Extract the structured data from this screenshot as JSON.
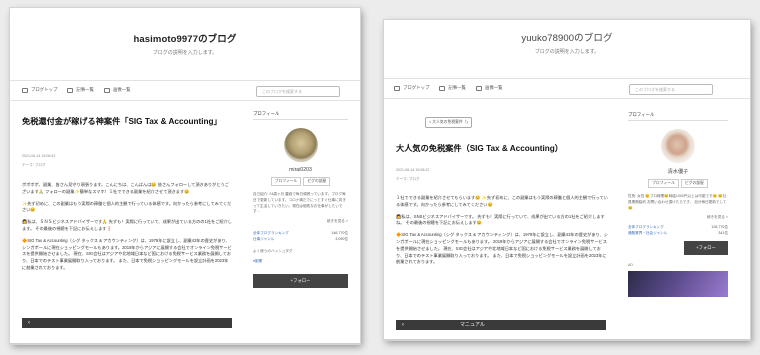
{
  "left": {
    "blog_title": "hasimoto9977のブログ",
    "blog_desc": "ブログの説明を入力します。",
    "menu": [
      "ブログトップ",
      "記事一覧",
      "画像一覧"
    ],
    "search_placeholder": "このブログを検索する",
    "article_title": "免税還付金が稼げる神案件「SIG Tax & Accounting」",
    "date": "2021-06-14 15:06:42",
    "category": "テーマ: ブログ",
    "paragraphs": [
      "ボボボボ、副業、皆さん見守り頑張ります。こんにちは、こんばんは😊 皆さんフォローして頂きありがとうございます🙏 フォローの副業✨簡単なスマホ！１社でできる副業を紹介させて頂きます😊",
      "✨先ず初めに、この副業はもう実際の稼働と個人的主観で行っている体感です。向かったら参考にしてみてください😊",
      "👩私は、ＳＮＳビジネスアドバイザーです🙏 先ずも！実際に行っていて、成果が出ている方のの1社をご紹介します。 その最後の視聴を下記にお伝えします❗",
      "🔶SIG Tax & Accounting（シグ タックス & アカウンティング）は、1979年に設立し、副業43年の歴史があり、シンガポールに現在ショッピングモールもあります。2019年からアジアに展開する会社でオンライン免税サービスを提供開始させました。 現在、SIG会社はアジアや北地域日本など国における免税サービス業務を展開しており、日本でのテスト事業展開取り入っております。 また、日本で免税ショッピングモールを設立計画を2023年に創業されております。"
    ],
    "profile_heading": "プロフィール",
    "username": "mirai0203",
    "profile_btns": [
      "プロフィール",
      "ピグの部屋"
    ],
    "profile_desc": "自己紹介: 24歳ヶ月 農経で毎日頑張っています。ブログ毎日で更新しています。コロナ禍だでにっとすぐ仕事に向きって生活していきたい。現在は個別なお仕事がしたいです...",
    "read_more": "続きを見る >",
    "rankings": [
      {
        "label": "全体ブログランキング",
        "value": "146,770位"
      },
      {
        "label": "仕事ジャンル",
        "value": "3,090位"
      }
    ],
    "recent_label": "よく使うのハッシュタグ",
    "tag_link": "#副業",
    "follow_label": "+フォロー"
  },
  "right": {
    "blog_title": "yuuko78900のブログ",
    "blog_desc": "ブログの説明を入力します。",
    "menu": [
      "ブログトップ",
      "記事一覧",
      "画像一覧"
    ],
    "search_placeholder": "このブログを検索する",
    "prev_tag": "< 大人気の免税案件（)",
    "article_title": "大人気の免税案件（SIG Tax & Accounting）",
    "date": "2021-06-14 15:06:22",
    "category": "テーマ: ブログ",
    "paragraphs": [
      "１社でできる副業を紹介させてもらいます😊 ✨先ず初めに、この副業はもう実際の稼働と個人的主観で行っている体感です。向かったら参考にしてみてください😊",
      "👩私は、SNSビジネスアドバイザーです。 先ずも！実際に行っていて、成果が出ている方の1社をご紹介しますね。 その最後の視聴を下記にお伝えします😊",
      "🔶SIG Tax & Accounting（シグ タックス & アカウンティング）は、1979年に設立し、副業43年の歴史があり、シンガポールに現在ショッピングモールもあります。 2019年からアジアに展開する会社でオンライン免税サービスを提供開始させました。 現在、SIG会社はアジアや北地域日本など国における免税サービス業務を展開しており、日本でのテスト事業展開取り入っております。 また、日本で免税ショッピングモールを設立計画を2023年に創業されております。"
    ],
    "profile_heading": "プロフィール",
    "username": "清水優子",
    "profile_btns": [
      "プロフィール",
      "ピグの部屋"
    ],
    "profile_desc": "性別: 女性 😊プロ稼業😊時給1000円以上は可能です😊 😊社員業務給約 お問い合わせ頂けたらです、 自分毎日更新でして😊",
    "read_more": "続きを見る >",
    "rankings": [
      {
        "label": "全体ブログランキング",
        "value": "126,770位"
      },
      {
        "label": "通販業界・社会ジャンル",
        "value": "341位"
      }
    ],
    "follow_label": "+フォロー",
    "ad_label": "AD",
    "manual_label": "マニュアル"
  }
}
